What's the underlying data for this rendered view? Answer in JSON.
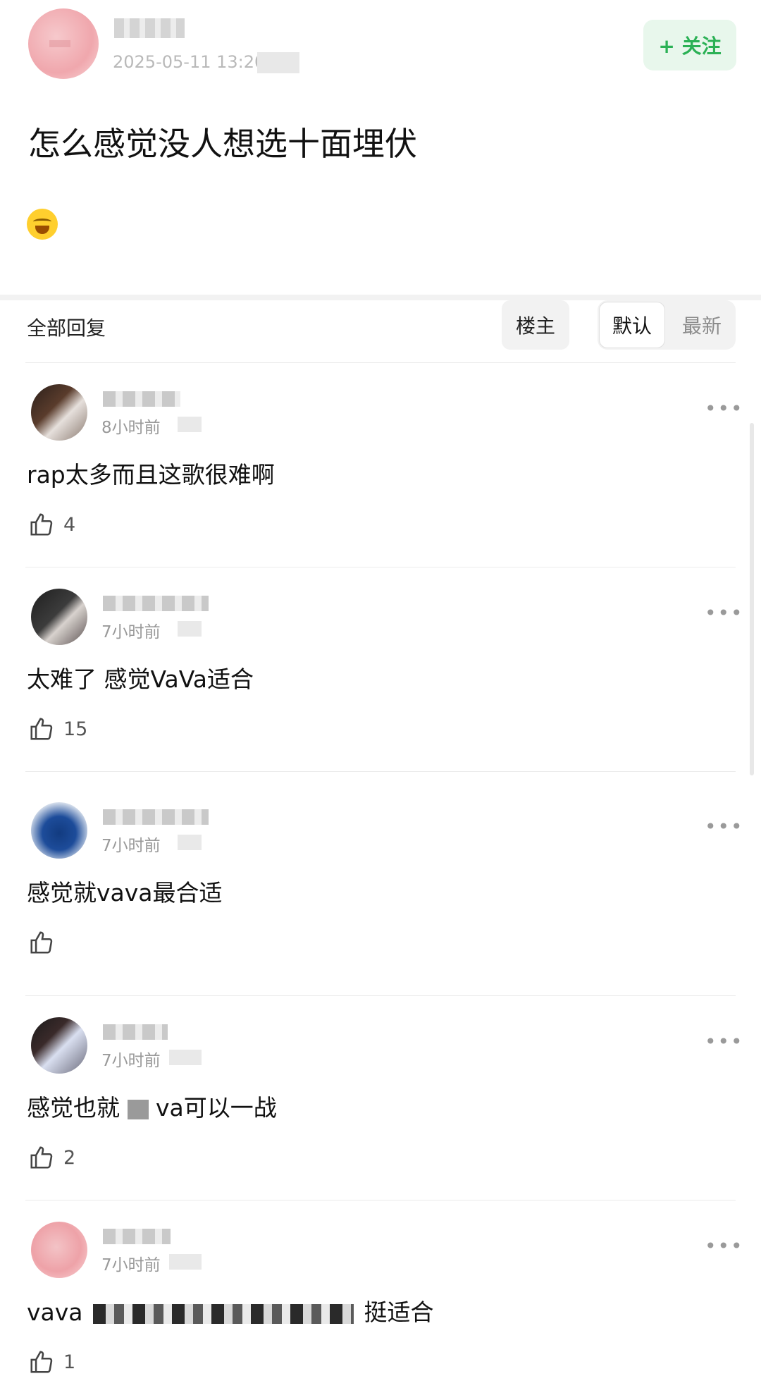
{
  "post": {
    "timestamp": "2025-05-11 13:20",
    "follow_label": "+ 关注",
    "title": "怎么感觉没人想选十面埋伏",
    "emoji": "rolling-on-floor-laughing"
  },
  "replies": {
    "header": "全部回复",
    "filter_op": "楼主",
    "sort_default": "默认",
    "sort_newest": "最新"
  },
  "comments": [
    {
      "time": "8小时前",
      "text": "rap太多而且这歌很难啊",
      "likes": "4"
    },
    {
      "time": "7小时前",
      "text": "太难了 感觉VaVa适合",
      "likes": "15"
    },
    {
      "time": "7小时前",
      "text": "感觉就vava最合适",
      "likes": ""
    },
    {
      "time": "7小时前",
      "text_prefix": "感觉也就",
      "text_suffix": "va可以一战",
      "likes": "2"
    },
    {
      "time": "7小时前",
      "text_prefix": "vava",
      "text_suffix": "挺适合",
      "likes": "1"
    }
  ],
  "colors": {
    "accent_green": "#2bb155",
    "follow_bg": "#e8f7ec"
  },
  "icons": [
    "thumbs-up-icon",
    "more-dots-icon",
    "plus-icon"
  ]
}
